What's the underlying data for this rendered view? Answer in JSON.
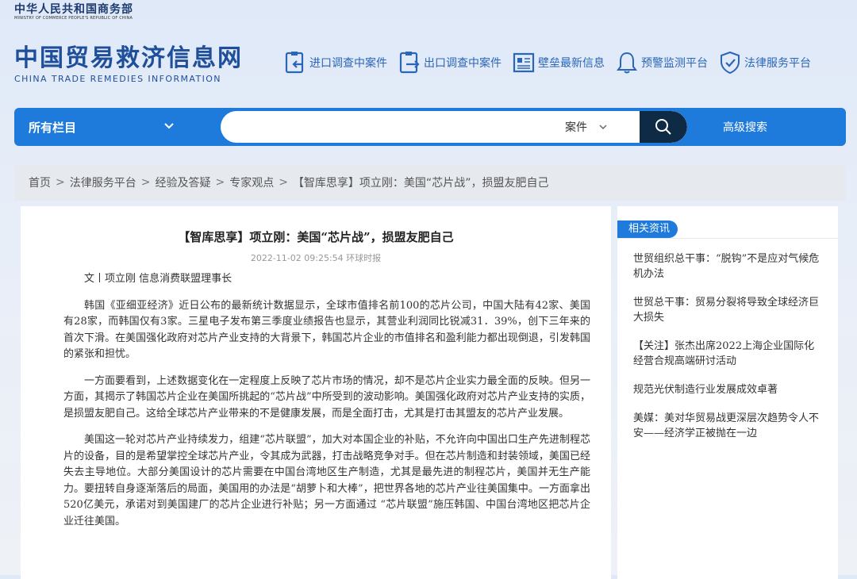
{
  "header": {
    "ministry_cn": "中华人民共和国商务部",
    "ministry_en": "MINISTRY OF COMMERCE PEOPLE'S REPUBLIC OF CHINA",
    "site_cn": "中国贸易救济信息网",
    "site_en": "CHINA TRADE REMEDIES INFORMATION"
  },
  "nav": [
    {
      "label": "进口调查中案件",
      "icon": "import-case-icon"
    },
    {
      "label": "出口调查中案件",
      "icon": "export-case-icon"
    },
    {
      "label": "壁垒最新信息",
      "icon": "barrier-info-icon"
    },
    {
      "label": "预警监测平台",
      "icon": "bell-icon"
    },
    {
      "label": "法律服务平台",
      "icon": "shield-check-icon"
    }
  ],
  "search": {
    "scope_label": "所有栏目",
    "placeholder": "",
    "type_label": "案件",
    "advanced_label": "高级搜索"
  },
  "breadcrumb": [
    "首页",
    "法律服务平台",
    "经验及答疑",
    "专家观点",
    "【智库思享】项立刚：美国“芯片战”，损盟友肥自己"
  ],
  "article": {
    "title": "【智库思享】项立刚：美国“芯片战”，损盟友肥自己",
    "meta": "2022-11-02 09:25:54 环球时报",
    "author": "文丨项立刚 信息消费联盟理事长",
    "paragraphs": [
      "韩国《亚细亚经济》近日公布的最新统计数据显示，全球市值排名前100的芯片公司，中国大陆有42家、美国有28家，而韩国仅有3家。三星电子发布第三季度业绩报告也显示，其营业利润同比锐减31．39%，创下三年来的首次下滑。在美国强化政府对芯片产业支持的大背景下，韩国芯片企业的市值排名和盈利能力都出现倒退，引发韩国的紧张和担忧。",
      "一方面要看到，上述数据变化在一定程度上反映了芯片市场的情况，却不是芯片企业实力最全面的反映。但另一方面，其揭示了韩国芯片企业在美国所挑起的“芯片战”中所受到的波动影响。美国强化政府对芯片产业支持的实质，是损盟友肥自己。这给全球芯片产业带来的不是健康发展，而是全面打击，尤其是打击其盟友的芯片产业发展。",
      "美国这一轮对芯片产业持续发力，组建“芯片联盟”，加大对本国企业的补贴，不允许向中国出口生产先进制程芯片的设备，目的是希望掌控全球芯片产业，令其成为武器，打击战略竞争对手。但在芯片制造和封装领域，美国已经失去主导地位。大部分美国设计的芯片需要在中国台湾地区生产制造，尤其是最先进的制程芯片，美国并无生产能力。要扭转自身逐渐落后的局面，美国用的办法是“胡萝卜和大棒”，把世界各地的芯片产业往美国集中。一方面拿出520亿美元，承诺对到美国建厂的芯片企业进行补贴；另一方面通过 “芯片联盟”施压韩国、中国台湾地区把芯片企业迁往美国。"
    ]
  },
  "sidebar": {
    "title": "相关资讯",
    "items": [
      "世贸组织总干事：“脱钩”不是应对气候危机办法",
      "世贸总干事：贸易分裂将导致全球经济巨大损失",
      "【关注】张杰出席2022上海企业国际化经营合规高端研讨活动",
      "规范光伏制造行业发展成效卓著",
      "美媒：美对华贸易战更深层次趋势令人不安——经济学正被抛在一边"
    ]
  },
  "colors": {
    "brand_blue": "#1e7bdb",
    "logo_blue": "#1f4f9a",
    "nav_blue": "#2a66b8",
    "search_button": "#0f2a45"
  }
}
